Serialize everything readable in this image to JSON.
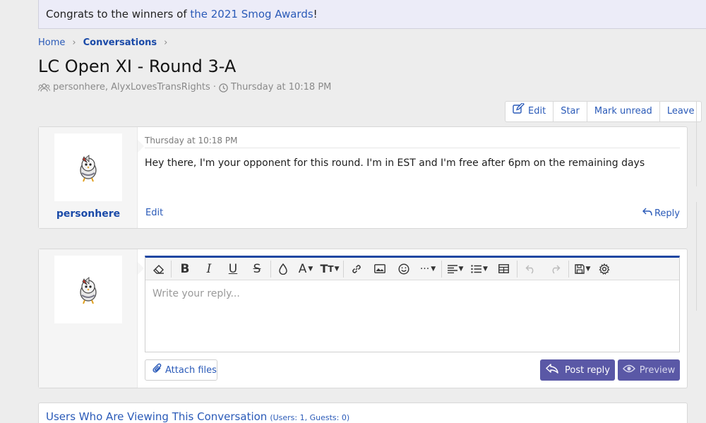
{
  "notice": {
    "prefix": "Congrats to the winners of ",
    "link": "the 2021 Smog Awards",
    "suffix": "!"
  },
  "breadcrumb": {
    "home": "Home",
    "current": "Conversations"
  },
  "page_title": "LC Open XI - Round 3-A",
  "meta": {
    "participants": "personhere, AlyxLovesTransRights",
    "separator": "·",
    "date": "Thursday at 10:18 PM"
  },
  "actions": {
    "edit": "Edit",
    "star": "Star",
    "mark_unread": "Mark unread",
    "leave": "Leave"
  },
  "message": {
    "username": "personhere",
    "date": "Thursday at 10:18 PM",
    "body": "Hey there, I'm your opponent for this round. I'm in EST and I'm free after 6pm on the remaining days",
    "edit": "Edit",
    "reply": "Reply"
  },
  "reply_box": {
    "placeholder": "Write your reply...",
    "attach": "Attach files",
    "post": "Post reply",
    "preview": "Preview"
  },
  "viewers": {
    "heading": "Users Who Are Viewing This Conversation",
    "counts": "(Users: 1, Guests: 0)"
  },
  "icons": [
    "eraser-icon",
    "bold-icon",
    "italic-icon",
    "underline-icon",
    "strikethrough-icon",
    "text-color-icon",
    "font-family-icon",
    "font-size-icon",
    "link-icon",
    "image-icon",
    "smilie-icon",
    "more-icon",
    "align-icon",
    "list-icon",
    "table-icon",
    "undo-icon",
    "redo-icon",
    "drafts-icon",
    "settings-icon"
  ],
  "colors": {
    "link": "#2a5ab8",
    "accent": "#1f46a2",
    "button": "#5a58a6"
  }
}
